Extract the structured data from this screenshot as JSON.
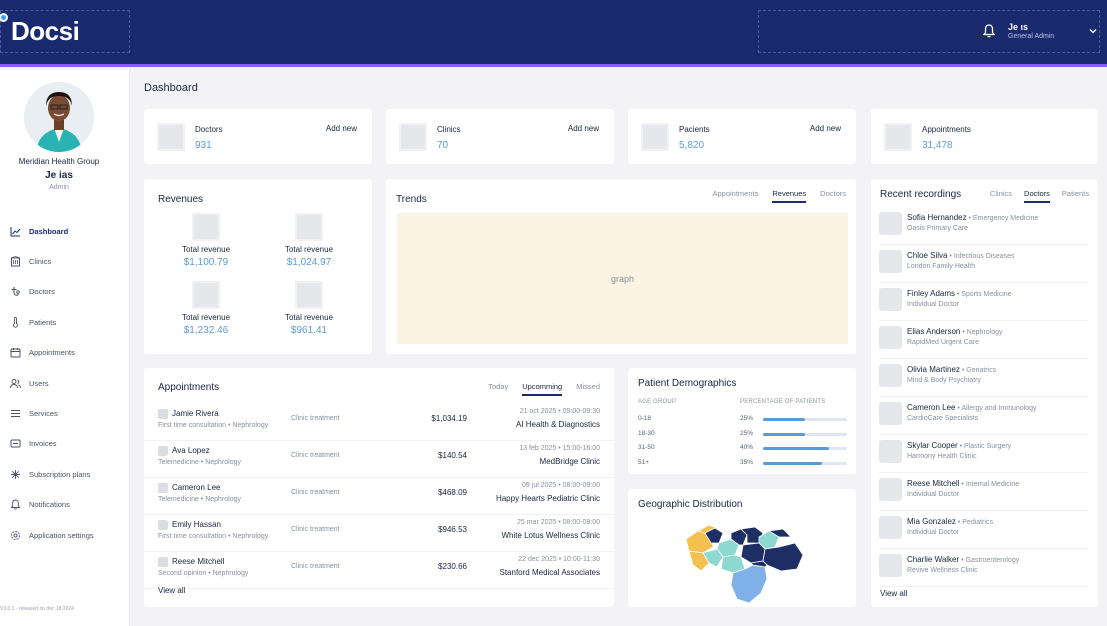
{
  "header": {
    "logo_text": "Docsi",
    "user_name": "Je            ıs",
    "user_role": "General Admin"
  },
  "sidebar": {
    "org": "Meridian Health Group",
    "user_name": "Je            ias",
    "user_role": "Admin",
    "items": [
      {
        "label": "Dashboard",
        "icon": "chart-icon"
      },
      {
        "label": "Clinics",
        "icon": "building-icon"
      },
      {
        "label": "Doctors",
        "icon": "stethoscope-icon"
      },
      {
        "label": "Patients",
        "icon": "thermometer-icon"
      },
      {
        "label": "Appointments",
        "icon": "calendar-icon"
      },
      {
        "label": "Users",
        "icon": "users-icon"
      },
      {
        "label": "Services",
        "icon": "list-icon"
      },
      {
        "label": "Invoices",
        "icon": "invoice-icon"
      },
      {
        "label": "Subscription plans",
        "icon": "plans-icon"
      },
      {
        "label": "Notifications",
        "icon": "bell-icon"
      },
      {
        "label": "Application settings",
        "icon": "gear-icon"
      }
    ],
    "version": "V3.0.1 - released on dec 18 2024"
  },
  "page": {
    "title": "Dashboard"
  },
  "stats": [
    {
      "label": "Doctors",
      "value": "931",
      "action": "Add new"
    },
    {
      "label": "Clinics",
      "value": "70",
      "action": "Add new"
    },
    {
      "label": "Pacients",
      "value": "5,820",
      "action": "Add new"
    },
    {
      "label": "Appointments",
      "value": "31,478",
      "action": ""
    }
  ],
  "revenues": {
    "title": "Revenues",
    "items": [
      {
        "label": "Total revenue",
        "value": "$1,100.79"
      },
      {
        "label": "Total revenue",
        "value": "$1,024.97"
      },
      {
        "label": "Total revenue",
        "value": "$1,232.46"
      },
      {
        "label": "Total revenue",
        "value": "$961.41"
      }
    ]
  },
  "trends": {
    "title": "Trends",
    "tabs": [
      "Appointments",
      "Revenues",
      "Doctors"
    ],
    "graph_placeholder": "graph"
  },
  "appointments": {
    "title": "Appointments",
    "tabs": [
      "Today",
      "Upcomming",
      "Missed"
    ],
    "rows": [
      {
        "name": "Jamie Rivera",
        "sub": "First time consultation • Nephrology",
        "type": "Clinic treatment",
        "amount": "$1,034.19",
        "date": "21 oct 2025 • 09:00-09:30",
        "clinic": "AI Health & Diagnostics"
      },
      {
        "name": "Ava Lopez",
        "sub": "Telemedicine • Nephrology",
        "type": "Clinic treatment",
        "amount": "$140.54",
        "date": "13 feb 2025 • 15:00-16:00",
        "clinic": "MedBridge Clinic"
      },
      {
        "name": "Cameron Lee",
        "sub": "Telemedicine • Nephrology",
        "type": "Clinic treatment",
        "amount": "$468.09",
        "date": "09 jul 2025 • 08:00-09:00",
        "clinic": "Happy Hearts Pediatric Clinic"
      },
      {
        "name": "Emily Hassan",
        "sub": "First time consultation • Nephrology",
        "type": "Clinic treatment",
        "amount": "$946.53",
        "date": "25 mar 2025 • 08:00-09:00",
        "clinic": "White Lotus Wellness Clinic"
      },
      {
        "name": "Reese Mitchell",
        "sub": "Second opinion • Nephrology",
        "type": "Clinic treatment",
        "amount": "$230.66",
        "date": "22 dec 2025 • 10:00-11:30",
        "clinic": "Stanford Medical Associates"
      }
    ],
    "view_all": "View all"
  },
  "demographics": {
    "title": "Patient Demographics",
    "col_age": "AGE GROUP",
    "col_pct": "PERCENTAGE OF PATIENTS",
    "rows": [
      {
        "age": "0-18",
        "pct": "25%",
        "level": 0.5
      },
      {
        "age": "18-30",
        "pct": "25%",
        "level": 0.5
      },
      {
        "age": "31-50",
        "pct": "40%",
        "level": 0.78
      },
      {
        "age": "51+",
        "pct": "35%",
        "level": 0.7
      }
    ]
  },
  "geo": {
    "title": "Geographic Distribution"
  },
  "recordings": {
    "title": "Recent recordings",
    "tabs": [
      "Clinics",
      "Doctors",
      "Patients"
    ],
    "rows": [
      {
        "name": "Sofia Hernandez",
        "spec": "Emergency Medicine",
        "clinic": "Oasis Primary Care"
      },
      {
        "name": "Chloe Silva",
        "spec": "Infectious Diseases",
        "clinic": "London Family Health"
      },
      {
        "name": "Finley Adams",
        "spec": "Sports Medicine",
        "clinic": "Individual Doctor"
      },
      {
        "name": "Elias Anderson",
        "spec": "Nephrology",
        "clinic": "RapidMed Urgent Care"
      },
      {
        "name": "Olivia Martinez",
        "spec": "Geriatrics",
        "clinic": "Mind & Body Psychiatry"
      },
      {
        "name": "Cameron Lee",
        "spec": "Allergy and Immunology",
        "clinic": "CardioCare Specialists"
      },
      {
        "name": "Skylar Cooper",
        "spec": "Plastic Surgery",
        "clinic": "Harmony Health Clinic"
      },
      {
        "name": "Reese Mitchell",
        "spec": "Internal Medicine",
        "clinic": "Individual Doctor"
      },
      {
        "name": "Mia Gonzalez",
        "spec": "Pediatrics",
        "clinic": "Individual Doctor"
      },
      {
        "name": "Charlie Walker",
        "spec": "Gastroenterology",
        "clinic": "Revive Wellness Clinic"
      }
    ],
    "view_all": "View all"
  }
}
